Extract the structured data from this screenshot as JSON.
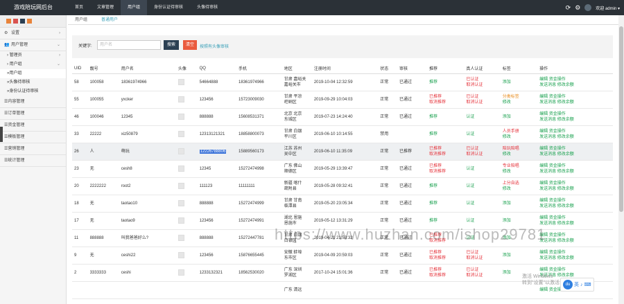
{
  "header": {
    "logo": "游戏陪玩网后台",
    "nav": [
      "首页",
      "文章管理",
      "用户组",
      "身份认证待审核",
      "头像待审核"
    ],
    "active_nav": 2,
    "icons": [
      "refresh-icon",
      "gear-icon"
    ],
    "user": "欢迎 admin ▾"
  },
  "sidebar": {
    "quick_colors": [
      "#e8833a",
      "#d9534f",
      "#2b3f52",
      "#e8833a"
    ],
    "items": [
      {
        "label": "设置",
        "icon": "gear-icon"
      },
      {
        "label": "用户管理",
        "icon": "users-icon"
      }
    ],
    "subs": [
      "管理员",
      "用户组"
    ],
    "subsubs": [
      "»用户组",
      "»头像待审核",
      "»身份认证待审核"
    ],
    "modules": [
      "内容管理",
      "订单管理",
      "资金管理",
      "模板管理",
      "营销管理",
      "统计管理"
    ]
  },
  "tabs": [
    "用户组",
    "普通用户"
  ],
  "search": {
    "label": "关键字:",
    "placeholder": "用户名",
    "search_button": "搜索",
    "clear_button": "清空",
    "hint": "按照有头像审核"
  },
  "table": {
    "headers": [
      "UID",
      "靓号",
      "用户名",
      "头像",
      "QQ",
      "手机",
      "地区",
      "注册时间",
      "状态",
      "审核",
      "推荐",
      "真人认证",
      "标签",
      "操作"
    ],
    "rows": [
      {
        "uid": "58",
        "num": "100058",
        "name": "18361974966",
        "qq": "54664888",
        "phone": "18361974966",
        "region": [
          "甘肃 嘉峪关",
          "嘉峪关市"
        ],
        "time": "2019-10-04 12:32:59",
        "status": "正常",
        "audit": "已通过",
        "rec": [
          "推荐"
        ],
        "real": [
          "已认证",
          "取消认证"
        ],
        "tag": [
          "添加"
        ],
        "ops": [
          "编辑 资金操作",
          "发送消息 修改余额"
        ]
      },
      {
        "uid": "55",
        "num": "100055",
        "name": "yxcker",
        "qq": "123456",
        "phone": "15723009030",
        "region": [
          "甘肃 平凉",
          "崆峒区"
        ],
        "time": "2019-09-29 10:04:03",
        "status": "正常",
        "audit": "已通过",
        "rec": [
          "已推荐",
          "取消推荐"
        ],
        "real": [
          "已认证",
          "取消认证"
        ],
        "tag": [
          "分类标签",
          "修改"
        ],
        "ops": [
          "编辑 资金操作",
          "发送消息 修改余额"
        ]
      },
      {
        "uid": "46",
        "num": "100046",
        "name": "12345",
        "qq": "888888",
        "phone": "15608531371",
        "region": [
          "北京 北京",
          "东城区"
        ],
        "time": "2019-07-23 14:24:40",
        "status": "正常",
        "audit": "已通过",
        "rec": [
          "推荐"
        ],
        "real": [
          "认证"
        ],
        "tag": [
          "添加"
        ],
        "ops": [
          "编辑 资金操作",
          "发送消息 修改余额"
        ]
      },
      {
        "uid": "33",
        "num": "22222",
        "name": "xiz50879",
        "qq": "12313121321",
        "phone": "18858800073",
        "region": [
          "甘肃 白银",
          "平川区"
        ],
        "time": "2019-06-10 10:14:55",
        "status": "禁用",
        "audit": "",
        "rec": [
          "推荐"
        ],
        "real": [
          "认证"
        ],
        "tag": [
          "人员手册",
          "修改"
        ],
        "ops": [
          "编辑 资金操作",
          "发送消息 修改余额"
        ]
      },
      {
        "uid": "26",
        "num": "人",
        "name": "萌玩",
        "qq": "12226788806",
        "phone": "15889560173",
        "region": [
          "江苏 苏州",
          "吴中区"
        ],
        "time": "2019-06-10 11:35:09",
        "status": "正常",
        "audit": "已推荐",
        "rec": [
          "已推荐",
          "取消推荐"
        ],
        "real": [
          "已认证",
          "取消认证"
        ],
        "tag": [
          "陪玩陪唱",
          "修改"
        ],
        "ops": [
          "编辑 资金操作",
          "发送消息 修改余额"
        ]
      },
      {
        "uid": "23",
        "num": "无",
        "name": "cesh8",
        "qq": "12345",
        "phone": "15272474998",
        "region": [
          "广东 佛山",
          "顺德区"
        ],
        "time": "2019-05-29 13:39:47",
        "status": "正常",
        "audit": "已通过",
        "rec": [
          "已推荐",
          "取消推荐"
        ],
        "real": [
          "认证"
        ],
        "tag": [
          "专业陪唱",
          "修改"
        ],
        "ops": [
          "编辑 资金操作",
          "发送消息 修改余额"
        ]
      },
      {
        "uid": "20",
        "num": "2222222",
        "name": "root2",
        "qq": "111123",
        "phone": "11111111",
        "region": [
          "新疆 喀什",
          "疏附县"
        ],
        "time": "2019-05-28 09:32:41",
        "status": "正常",
        "audit": "已通过",
        "rec": [
          "推荐"
        ],
        "real": [
          "认证"
        ],
        "tag": [
          "上分自选",
          "修改"
        ],
        "ops": [
          "编辑 资金操作",
          "发送消息 修改余额"
        ]
      },
      {
        "uid": "18",
        "num": "无",
        "name": "taotao10",
        "qq": "888888",
        "phone": "15272474999",
        "region": [
          "甘肃 甘南",
          "临潭县"
        ],
        "time": "2019-05-20 23:05:34",
        "status": "正常",
        "audit": "已通过",
        "rec": [
          "推荐"
        ],
        "real": [
          "认证"
        ],
        "tag": [
          "添加"
        ],
        "ops": [
          "编辑 资金操作",
          "发送消息 修改余额"
        ]
      },
      {
        "uid": "17",
        "num": "无",
        "name": "taotao9",
        "qq": "123456",
        "phone": "15272474991",
        "region": [
          "湖北 恩施",
          "恩施市"
        ],
        "time": "2019-05-12 13:31:29",
        "status": "正常",
        "audit": "已通过",
        "rec": [
          "推荐"
        ],
        "real": [
          "认证"
        ],
        "tag": [
          "添加"
        ],
        "ops": [
          "编辑 资金操作",
          "发送消息 修改余额"
        ]
      },
      {
        "uid": "11",
        "num": "888888",
        "name": "叫我爸爸好么?",
        "qq": "888888",
        "phone": "15272447781",
        "region": [
          "甘肃 白银",
          "白银区"
        ],
        "time": "2019-04-21 21:53:32",
        "status": "正常",
        "audit": "已通过",
        "rec": [
          "已推荐",
          "取消推荐"
        ],
        "real": [
          "认证"
        ],
        "tag": [
          "添加"
        ],
        "ops": [
          "编辑 资金操作",
          "发送消息 修改余额"
        ]
      },
      {
        "uid": "9",
        "num": "无",
        "name": "ceshi22",
        "qq": "123456",
        "phone": "15876655445",
        "region": [
          "安徽 蚌埠",
          "东市区"
        ],
        "time": "2019-04-09 20:59:03",
        "status": "正常",
        "audit": "已通过",
        "rec": [
          "已推荐",
          "取消推荐"
        ],
        "real": [
          "已认证",
          "取消认证"
        ],
        "tag": [
          "添加"
        ],
        "ops": [
          "编辑 资金操作",
          "发送消息 修改余额"
        ]
      },
      {
        "uid": "2",
        "num": "3333333",
        "name": "ceshi",
        "qq": "1233132321",
        "phone": "18562530020",
        "region": [
          "广东 深圳",
          "罗湖区"
        ],
        "time": "2017-10-24 15:01:36",
        "status": "正常",
        "audit": "已通过",
        "rec": [
          "已推荐",
          "取消推荐"
        ],
        "real": [
          "已认证",
          "取消认证"
        ],
        "tag": [
          "添加"
        ],
        "ops": [
          "编辑 资金操作",
          "发送消息 修改余额"
        ]
      },
      {
        "uid": "",
        "num": "",
        "name": "",
        "qq": "",
        "phone": "",
        "region": [
          "广东 清远",
          ""
        ],
        "time": "",
        "status": "",
        "audit": "",
        "rec": [],
        "real": [],
        "tag": [],
        "ops": [
          "编辑 资金操作"
        ]
      }
    ]
  },
  "watermark": "https://www.huzhan.com/ishop29781",
  "activate": [
    "激活 Windows",
    "转到\"设置\"以激活 Windows"
  ],
  "dock": [
    "du",
    "英",
    "♪",
    "⌨"
  ]
}
